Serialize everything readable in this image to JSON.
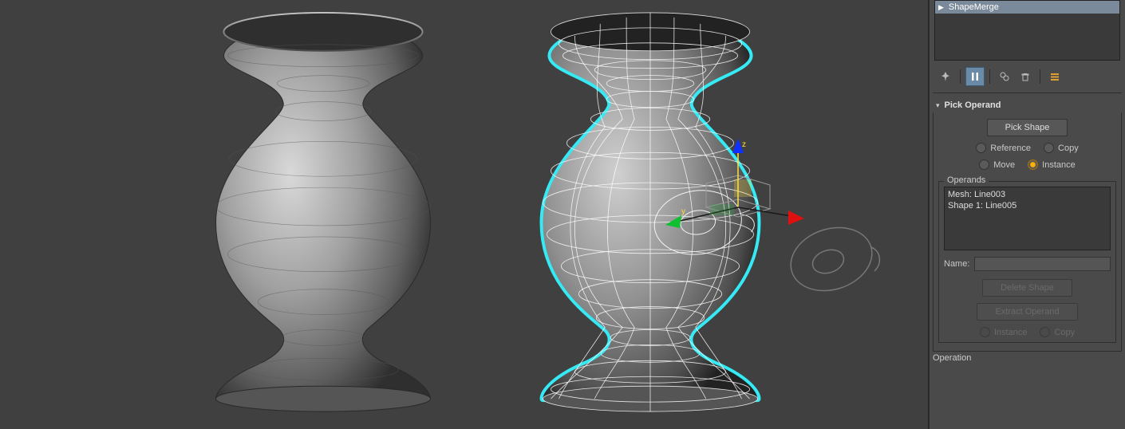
{
  "modifier_stack": {
    "item": "ShapeMerge"
  },
  "icons": {
    "pin": "📌",
    "toggle": "⏸",
    "pipe": "⚙",
    "trash": "🗑",
    "settings": "☰"
  },
  "rollout_pick": {
    "title": "Pick Operand",
    "pick_button": "Pick Shape",
    "radios": {
      "reference": "Reference",
      "copy": "Copy",
      "move": "Move",
      "instance": "Instance"
    },
    "operands_group": {
      "legend": "Operands",
      "items": [
        "Mesh: Line003",
        "Shape 1: Line005"
      ],
      "name_label": "Name:",
      "delete_button": "Delete Shape",
      "extract_button": "Extract Operand",
      "extract_radios": {
        "instance": "Instance",
        "copy": "Copy"
      }
    }
  },
  "rollout_operation": {
    "title": "Operation"
  }
}
